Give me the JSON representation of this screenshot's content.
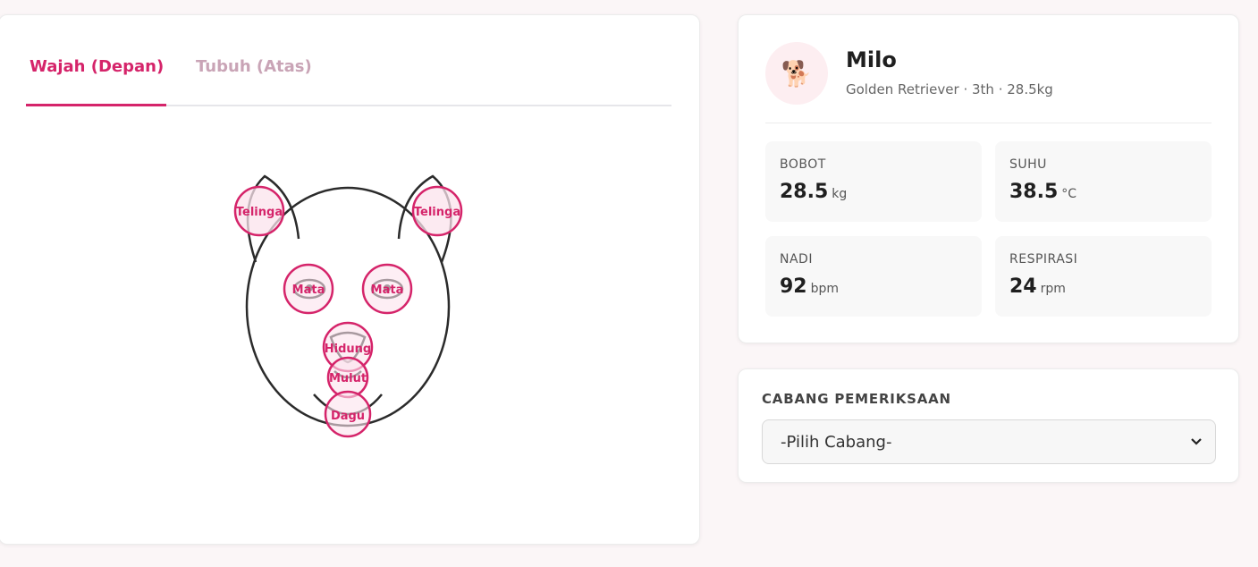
{
  "tabs": [
    {
      "label": "Wajah (Depan)",
      "active": true
    },
    {
      "label": "Tubuh (Atas)",
      "active": false
    }
  ],
  "face_regions": [
    {
      "id": "ear-left",
      "label": "Telinga"
    },
    {
      "id": "ear-right",
      "label": "Telinga"
    },
    {
      "id": "eye-left",
      "label": "Mata"
    },
    {
      "id": "eye-right",
      "label": "Mata"
    },
    {
      "id": "nose",
      "label": "Hidung"
    },
    {
      "id": "mouth",
      "label": "Mulut"
    },
    {
      "id": "chin",
      "label": "Dagu"
    }
  ],
  "patient": {
    "avatar_icon": "dog-icon",
    "avatar_glyph": "🐕",
    "name": "Milo",
    "info": "Golden Retriever · 3th · 28.5kg"
  },
  "vitals": [
    {
      "label": "BOBOT",
      "value": "28.5",
      "unit": "kg"
    },
    {
      "label": "SUHU",
      "value": "38.5",
      "unit": "°C"
    },
    {
      "label": "NADI",
      "value": "92",
      "unit": "bpm"
    },
    {
      "label": "RESPIRASI",
      "value": "24",
      "unit": "rpm"
    }
  ],
  "branch": {
    "label": "CABANG PEMERIKSAAN",
    "selected": "-Pilih Cabang-"
  },
  "colors": {
    "accent": "#d5246a",
    "region_fill": "#fbe3ec",
    "outline": "#2b2b2b"
  }
}
